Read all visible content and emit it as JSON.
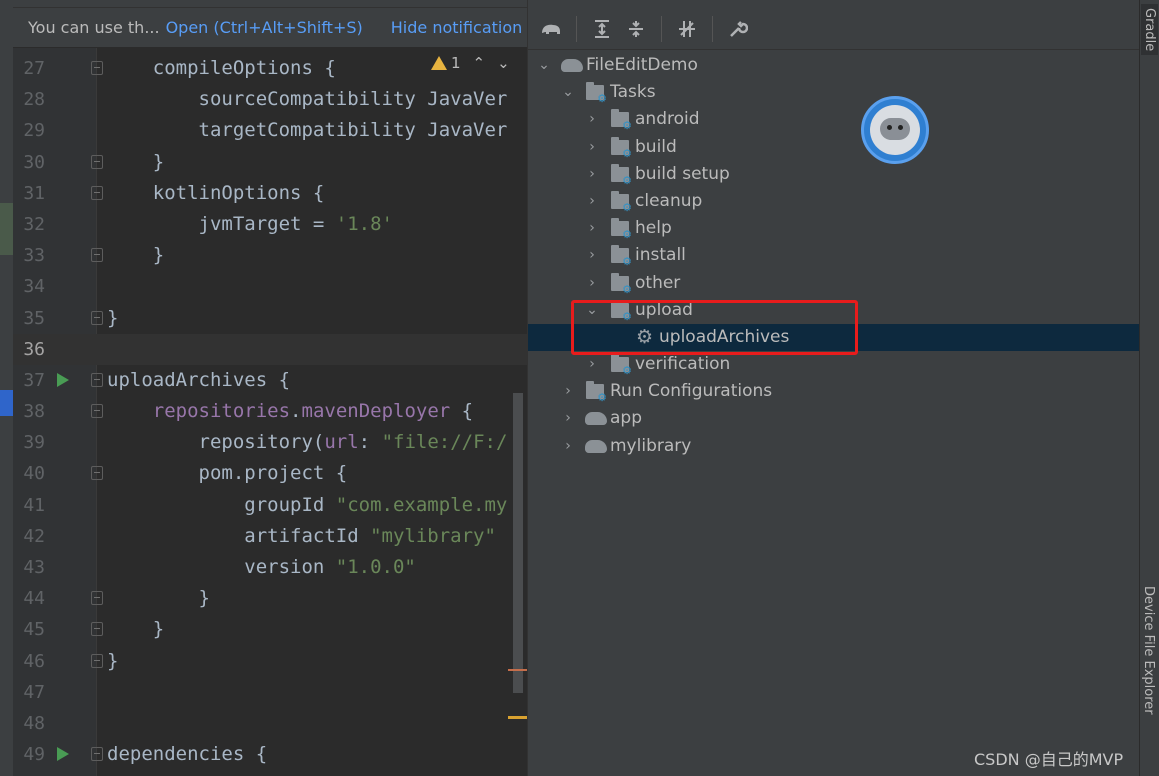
{
  "notification": {
    "message": "You can use th...",
    "open_link": "Open (Ctrl+Alt+Shift+S)",
    "hide_link": "Hide notification"
  },
  "inspection": {
    "count": "1"
  },
  "editor": {
    "lines": [
      {
        "num": "27",
        "fold": true
      },
      {
        "num": "28"
      },
      {
        "num": "29"
      },
      {
        "num": "30",
        "fold": true
      },
      {
        "num": "31",
        "fold": true
      },
      {
        "num": "32"
      },
      {
        "num": "33",
        "fold": true
      },
      {
        "num": "34"
      },
      {
        "num": "35",
        "fold": true
      },
      {
        "num": "36"
      },
      {
        "num": "37",
        "fold": true,
        "run": true
      },
      {
        "num": "38",
        "fold": true
      },
      {
        "num": "39"
      },
      {
        "num": "40",
        "fold": true
      },
      {
        "num": "41"
      },
      {
        "num": "42"
      },
      {
        "num": "43"
      },
      {
        "num": "44",
        "fold": true
      },
      {
        "num": "45",
        "fold": true
      },
      {
        "num": "46",
        "fold": true
      },
      {
        "num": "47"
      },
      {
        "num": "48"
      },
      {
        "num": "49",
        "fold": true,
        "run": true
      }
    ],
    "code": {
      "l27": "    compileOptions {",
      "l28a": "        sourceCompatibility ",
      "l28b": "JavaVer",
      "l29a": "        targetCompatibility ",
      "l29b": "JavaVer",
      "l30": "    }",
      "l31": "    kotlinOptions {",
      "l32a": "        jvmTarget = ",
      "l32b": "'1.8'",
      "l33": "    }",
      "l34": "",
      "l35": "}",
      "l36": "",
      "l37": "uploadArchives {",
      "l38a": "    ",
      "l38b": "repositories",
      "l38c": ".",
      "l38d": "mavenDeployer",
      "l38e": " {",
      "l39a": "        repository(",
      "l39b": "url",
      "l39c": ": ",
      "l39d": "\"file://F:/",
      "l40": "        pom.project {",
      "l41a": "            groupId ",
      "l41b": "\"com.example.my",
      "l42a": "            artifactId ",
      "l42b": "\"mylibrary\"",
      "l43a": "            version ",
      "l43b": "\"1.0.0\"",
      "l44": "        }",
      "l45": "    }",
      "l46": "}",
      "l47": "",
      "l48": "",
      "l49": "dependencies {"
    }
  },
  "gradle": {
    "toolbar": [
      "elephant-icon",
      "expand-all-icon",
      "collapse-all-icon",
      "toggle-offline-icon",
      "settings-wrench-icon"
    ],
    "tree": {
      "root": "FileEditDemo",
      "tasks": "Tasks",
      "android": "android",
      "build": "build",
      "build_setup": "build setup",
      "cleanup": "cleanup",
      "help": "help",
      "install": "install",
      "other": "other",
      "upload": "upload",
      "upload_archives": "uploadArchives",
      "verification": "verification",
      "run_configurations": "Run Configurations",
      "app": "app",
      "mylibrary": "mylibrary"
    },
    "selected": "uploadArchives",
    "highlight_color": "#e81c1c"
  },
  "sidebar_right": {
    "gradle_tab": "Gradle",
    "device_file_explorer_tab": "Device File Explorer"
  },
  "watermark": "CSDN @自己的MVP"
}
